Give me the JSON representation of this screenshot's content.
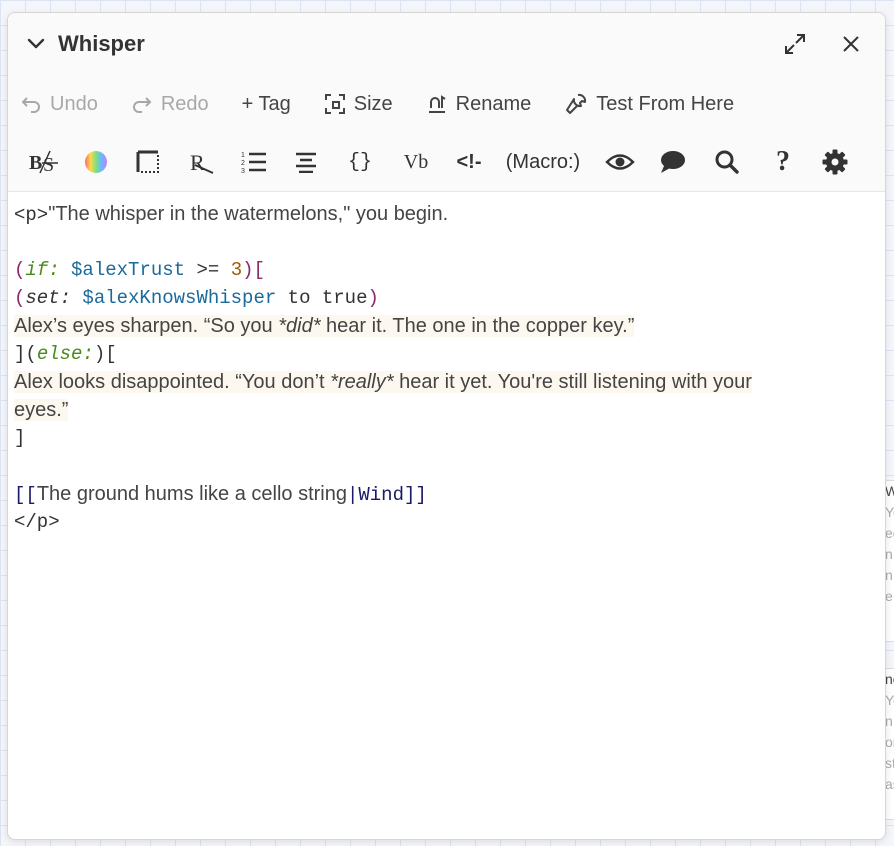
{
  "dialog": {
    "title": "Whisper"
  },
  "toolbar": {
    "undo": "Undo",
    "redo": "Redo",
    "tag": "+ Tag",
    "size": "Size",
    "rename": "Rename",
    "test": "Test From Here"
  },
  "format_bar": {
    "bold_strike": "B/S",
    "color": "rainbow",
    "border": "border",
    "align_right": "R",
    "list": "list",
    "center": "center",
    "braces": "{}",
    "verbatim": "Vb",
    "comment": "<!-",
    "macro": "(Macro:)",
    "preview": "eye",
    "comment_bubble": "speech",
    "find": "search",
    "help": "?",
    "settings": "gear"
  },
  "editor": {
    "l1_tag_open": "<p>",
    "l1_text": "\"The whisper in the watermelons,\" you begin.",
    "l3_open": "(",
    "l3_macro": "if:",
    "l3_var": "$alexTrust",
    "l3_op": ">=",
    "l3_num": "3",
    "l3_close": ")[",
    "l4_open": "(",
    "l4_macro": "set:",
    "l4_var": "$alexKnowsWhisper",
    "l4_rest": "to true",
    "l4_close": ")",
    "l5_a": "Alex’s eyes sharpen. “So you ",
    "l5_em": "*did*",
    "l5_b": " hear it. The one in the copper key.”",
    "l6_a": "](",
    "l6_macro": "else:",
    "l6_b": ")[",
    "l7_a": "Alex looks disappointed. “You don’t ",
    "l7_em": "*really*",
    "l7_b": " hear it yet. You're still listening with your",
    "l8": "eyes.”",
    "l9": "]",
    "l11_open": "[[",
    "l11_text": "The ground hums like a cello string",
    "l11_pipe": "|",
    "l11_target": "Wind",
    "l11_close": "]]",
    "l12": "</p>"
  },
  "background_cards": {
    "card1": [
      "Wi",
      "Yo",
      "ed",
      "n",
      "n",
      "e"
    ],
    "card2": [
      "ne",
      "Yo",
      "n",
      "or",
      "st",
      "as"
    ]
  }
}
